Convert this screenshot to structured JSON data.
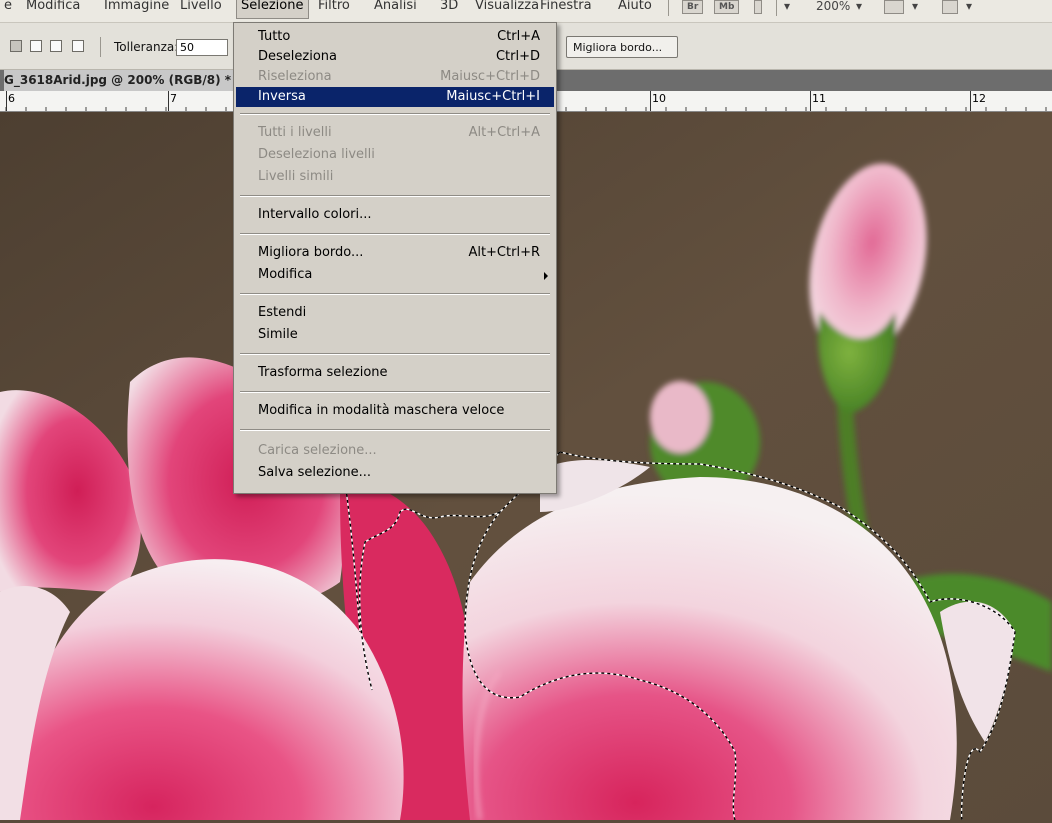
{
  "menubar": {
    "items": [
      "e",
      "Modifica",
      "Immagine",
      "Livello",
      "Selezione",
      "Filtro",
      "Analisi",
      "3D",
      "Visualizza",
      "Finestra",
      "Aiuto"
    ],
    "active": "Selezione",
    "badges": [
      "Br",
      "Mb"
    ],
    "zoom": "200%"
  },
  "options": {
    "tolerance_label": "Tolleranza:",
    "tolerance_value": "50",
    "refine_edge_label": "Migliora bordo..."
  },
  "document": {
    "tab_title": "G_3618Arid.jpg @ 200% (RGB/8) * ("
  },
  "ruler": {
    "labels": [
      "6",
      "7",
      "10",
      "11",
      "12"
    ]
  },
  "selection_menu": {
    "items": [
      {
        "label": "Tutto",
        "shortcut": "Ctrl+A",
        "enabled": true
      },
      {
        "label": "Deseleziona",
        "shortcut": "Ctrl+D",
        "enabled": true
      },
      {
        "label": "Riseleziona",
        "shortcut": "Maiusc+Ctrl+D",
        "enabled": false
      },
      {
        "label": "Inversa",
        "shortcut": "Maiusc+Ctrl+I",
        "enabled": true,
        "highlighted": true
      },
      {
        "label": "Tutti i livelli",
        "shortcut": "Alt+Ctrl+A",
        "enabled": false
      },
      {
        "label": "Deseleziona livelli",
        "shortcut": "",
        "enabled": false
      },
      {
        "label": "Livelli simili",
        "shortcut": "",
        "enabled": false
      },
      {
        "label": "Intervallo colori...",
        "shortcut": "",
        "enabled": true
      },
      {
        "label": "Migliora bordo...",
        "shortcut": "Alt+Ctrl+R",
        "enabled": true
      },
      {
        "label": "Modifica",
        "shortcut": "",
        "enabled": true,
        "submenu": true
      },
      {
        "label": "Estendi",
        "shortcut": "",
        "enabled": true
      },
      {
        "label": "Simile",
        "shortcut": "",
        "enabled": true
      },
      {
        "label": "Trasforma selezione",
        "shortcut": "",
        "enabled": true
      },
      {
        "label": "Modifica in modalità maschera veloce",
        "shortcut": "",
        "enabled": true
      },
      {
        "label": "Carica selezione...",
        "shortcut": "",
        "enabled": false
      },
      {
        "label": "Salva selezione...",
        "shortcut": "",
        "enabled": true
      }
    ]
  },
  "colors": {
    "menu_highlight": "#0a246a",
    "menu_bg": "#d4d0c8",
    "photo_background": "#5e4e3e",
    "petal_pink": "#e0306a"
  }
}
